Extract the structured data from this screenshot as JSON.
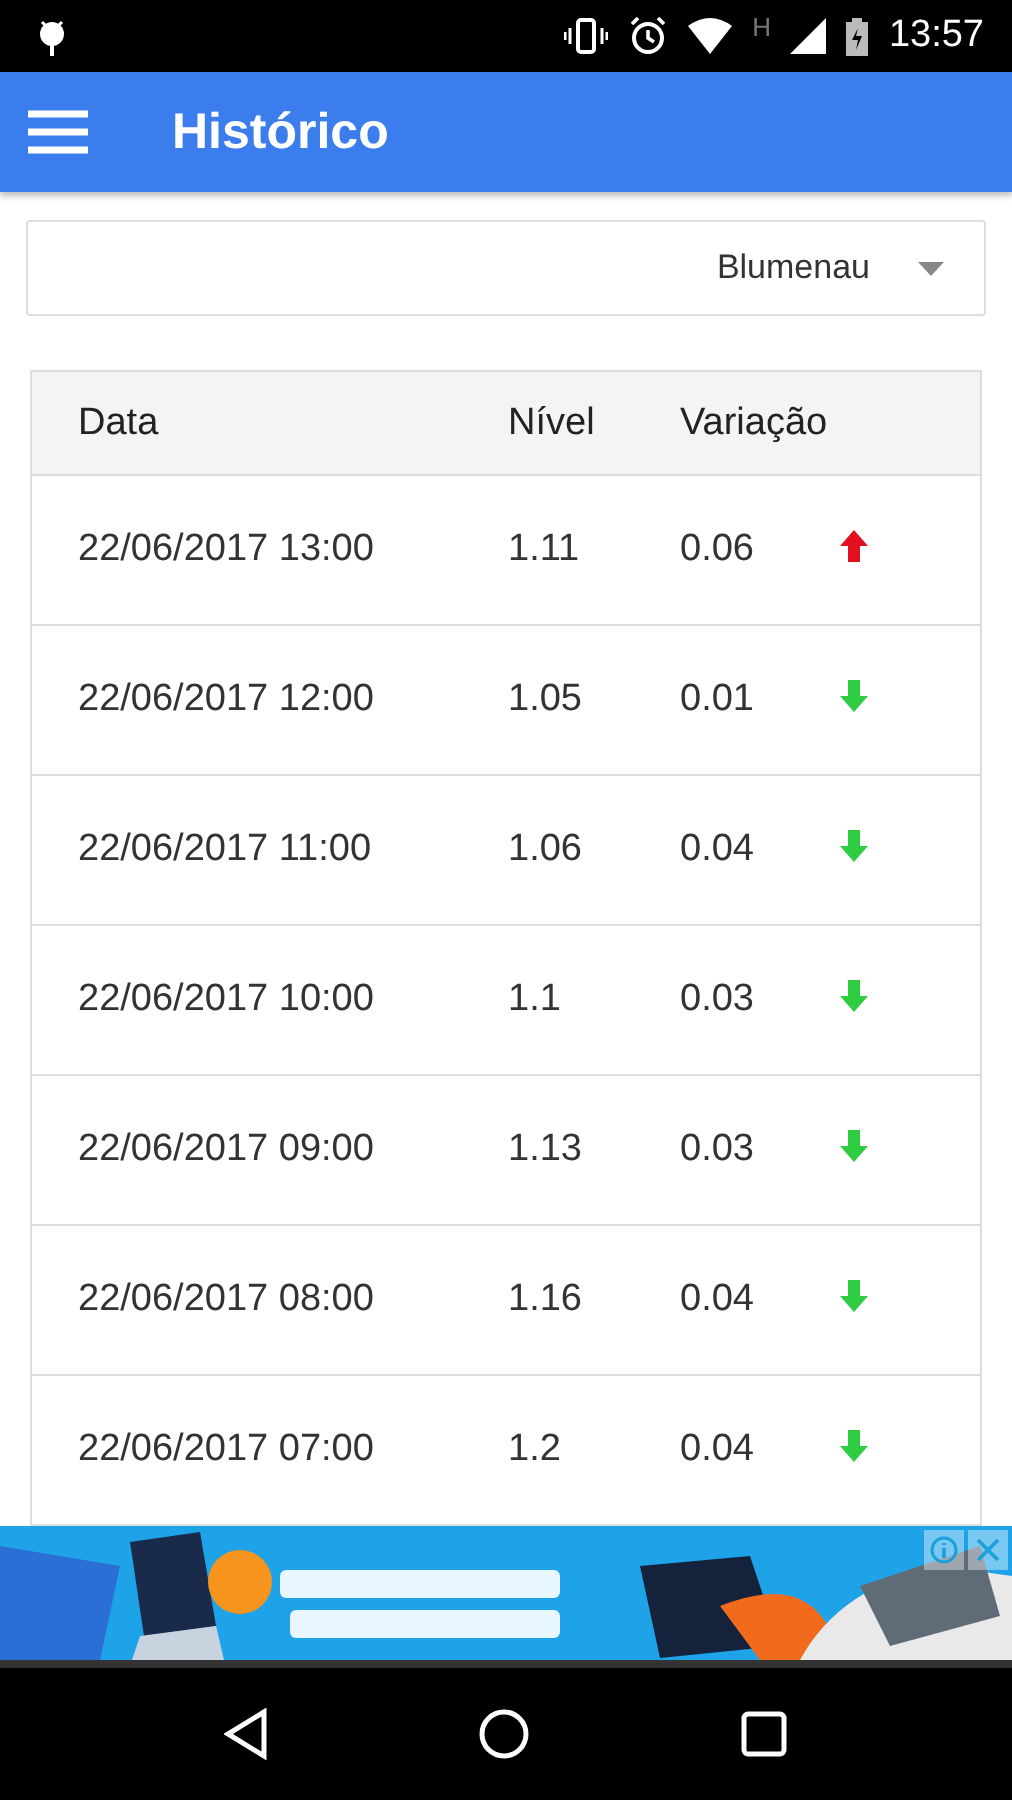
{
  "status_bar": {
    "network_type": "H",
    "time": "13:57"
  },
  "app_bar": {
    "title": "Histórico"
  },
  "city_select": {
    "value": "Blumenau"
  },
  "table": {
    "columns": [
      "Data",
      "Nível",
      "Variação"
    ],
    "rows": [
      {
        "date": "22/06/2017 13:00",
        "level": "1.11",
        "variation": "0.06",
        "rising": true
      },
      {
        "date": "22/06/2017 12:00",
        "level": "1.05",
        "variation": "0.01",
        "rising": false
      },
      {
        "date": "22/06/2017 11:00",
        "level": "1.06",
        "variation": "0.04",
        "rising": false
      },
      {
        "date": "22/06/2017 10:00",
        "level": "1.1",
        "variation": "0.03",
        "rising": false
      },
      {
        "date": "22/06/2017 09:00",
        "level": "1.13",
        "variation": "0.03",
        "rising": false
      },
      {
        "date": "22/06/2017 08:00",
        "level": "1.16",
        "variation": "0.04",
        "rising": false
      },
      {
        "date": "22/06/2017 07:00",
        "level": "1.2",
        "variation": "0.04",
        "rising": false
      }
    ]
  }
}
